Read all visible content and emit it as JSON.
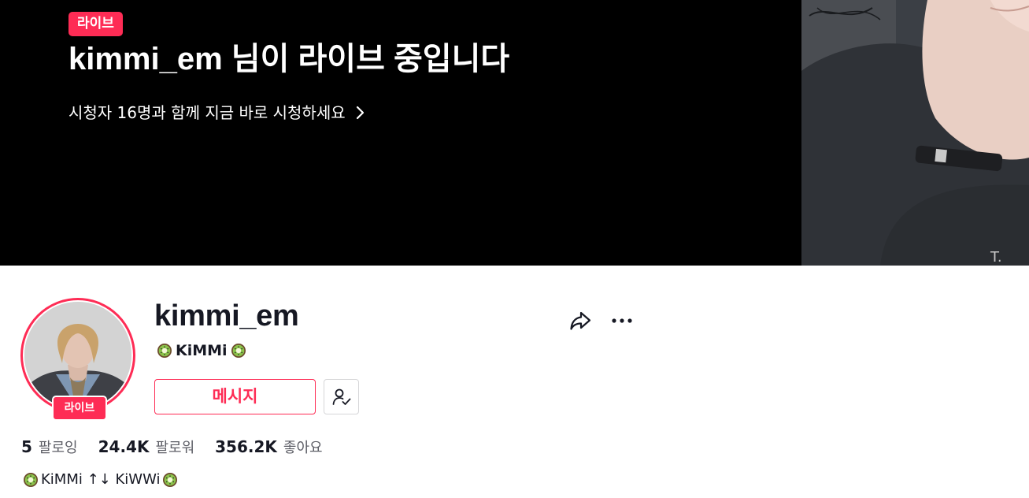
{
  "banner": {
    "live_tag": "라이브",
    "title": "kimmi_em 님이 라이브 중입니다",
    "subtitle": "시청자 16명과 함께 지금 바로 시청하세요"
  },
  "profile": {
    "avatar_live_tag": "라이브",
    "username": "kimmi_em",
    "nickname": "KiMMi",
    "message_button": "메시지",
    "stats": [
      {
        "value": "5",
        "label": "팔로잉"
      },
      {
        "value": "24.4K",
        "label": "팔로워"
      },
      {
        "value": "356.2K",
        "label": "좋아요"
      }
    ],
    "bio": "KiMMi ↑↓ KiWWi"
  },
  "icons": {
    "share": "share-arrow-icon",
    "more": "more-dots-icon",
    "following": "user-check-icon",
    "chevron": "chevron-right-icon",
    "emoji": "kiwi-icon"
  },
  "colors": {
    "accent": "#fe2c55",
    "banner_bg": "#000000",
    "text_primary": "#161823",
    "text_secondary": "#5c5d65"
  }
}
